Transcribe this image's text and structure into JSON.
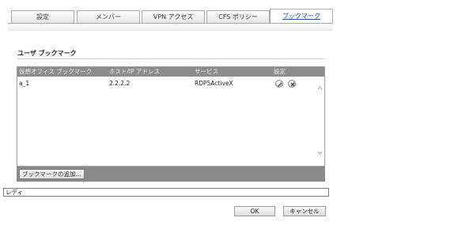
{
  "tabs": [
    {
      "label": "設定",
      "active": false
    },
    {
      "label": "メンバー",
      "active": false
    },
    {
      "label": "VPN アクセス",
      "active": false
    },
    {
      "label": "CFS ポリシー",
      "active": false
    },
    {
      "label": "ブックマーク",
      "active": true
    }
  ],
  "section": {
    "title": "ユーザ ブックマーク"
  },
  "table": {
    "columns": [
      "仮想オフィス ブックマーク",
      "ホスト/IP アドレス",
      "サービス",
      "設定"
    ],
    "rows": [
      {
        "name": "a_1",
        "host": "2.2.2.2",
        "service": "RDP5ActiveX",
        "actions": [
          "edit-icon",
          "delete-icon"
        ]
      }
    ]
  },
  "add_button": {
    "label": "ブックマークの追加..."
  },
  "status": {
    "text": "レディ"
  },
  "buttons": {
    "ok": "OK",
    "cancel": "キャンセル"
  }
}
